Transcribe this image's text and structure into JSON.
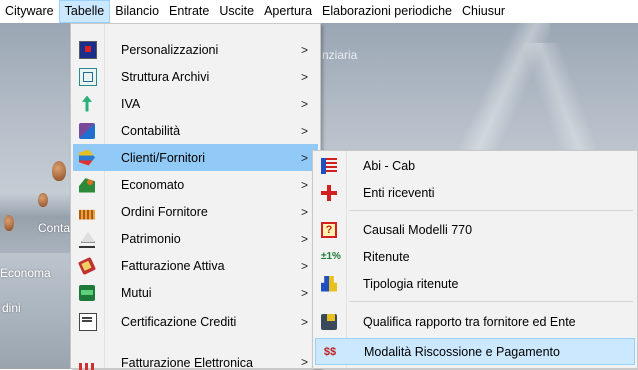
{
  "menubar": {
    "items": [
      "Cityware",
      "Tabelle",
      "Bilancio",
      "Entrate",
      "Uscite",
      "Apertura",
      "Elaborazioni periodiche",
      "Chiusur"
    ],
    "active_index": 1
  },
  "background": {
    "title": "nziaria",
    "labels": [
      "Conta",
      "Economa",
      "dini"
    ]
  },
  "menu_tabelle": {
    "items": [
      {
        "label": "Personalizzazioni",
        "icon": "personalization-icon",
        "submenu": ">"
      },
      {
        "label": "Struttura Archivi",
        "icon": "archive-structure-icon",
        "submenu": ">"
      },
      {
        "label": "IVA",
        "icon": "iva-icon",
        "submenu": ">"
      },
      {
        "label": "Contabilità",
        "icon": "accounting-icon",
        "submenu": ">"
      },
      {
        "label": "Clienti/Fornitori",
        "icon": "clients-suppliers-icon",
        "submenu": ">"
      },
      {
        "label": "Economato",
        "icon": "economato-icon",
        "submenu": ">"
      },
      {
        "label": "Ordini Fornitore",
        "icon": "supplier-orders-icon",
        "submenu": ">"
      },
      {
        "label": "Patrimonio",
        "icon": "patrimony-icon",
        "submenu": ">"
      },
      {
        "label": "Fatturazione Attiva",
        "icon": "active-invoicing-icon",
        "submenu": ">"
      },
      {
        "label": "Mutui",
        "icon": "loans-icon",
        "submenu": ">"
      },
      {
        "label": "Certificazione Crediti",
        "icon": "credit-certification-icon",
        "submenu": ">"
      },
      {
        "label": "Fatturazione Elettronica",
        "icon": "electronic-invoicing-icon",
        "submenu": ">"
      }
    ],
    "highlighted": "Clienti/Fornitori"
  },
  "menu_clienti_fornitori": {
    "items": [
      {
        "label": "Abi - Cab",
        "icon": "abi-cab-icon"
      },
      {
        "label": "Enti riceventi",
        "icon": "receiving-entities-icon"
      },
      {
        "label": "Causali Modelli 770",
        "icon": "causali-770-icon"
      },
      {
        "label": "Ritenute",
        "icon": "withholding-icon",
        "icon_text": "±1%"
      },
      {
        "label": "Tipologia ritenute",
        "icon": "withholding-types-icon"
      },
      {
        "label": "Qualifica rapporto tra fornitore ed Ente",
        "icon": "relationship-qualification-icon"
      },
      {
        "label": "Modalità Riscossione e Pagamento",
        "icon": "payment-methods-icon",
        "icon_text": "$$"
      }
    ],
    "highlighted": "Modalità Riscossione e Pagamento"
  },
  "colors": {
    "highlight": "#91c9f7",
    "highlight_light": "#cce8ff",
    "menu_bg": "#f2f2f2"
  }
}
